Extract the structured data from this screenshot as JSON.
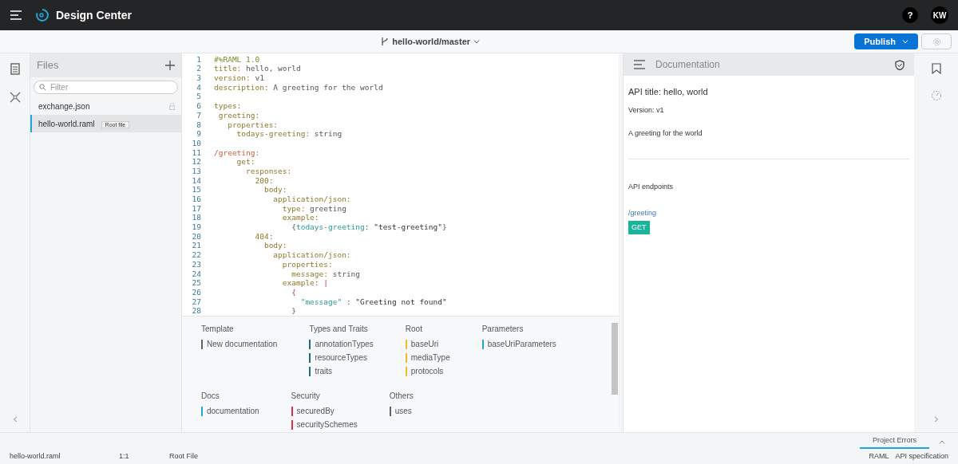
{
  "app": {
    "title": "Design Center",
    "help": "?",
    "avatar": "KW"
  },
  "toolbar": {
    "branch": "hello-world/master",
    "publish": "Publish"
  },
  "files": {
    "title": "Files",
    "filter_placeholder": "Filter",
    "items": [
      {
        "name": "exchange.json",
        "selected": false,
        "locked": true
      },
      {
        "name": "hello-world.raml",
        "selected": true,
        "badge": "Root file"
      }
    ]
  },
  "editor": {
    "lines": [
      {
        "number": "1",
        "tokens": [
          {
            "kind": "comment",
            "text": "#%RAML 1.0"
          }
        ]
      },
      {
        "number": "2",
        "tokens": [
          {
            "kind": "key",
            "text": "title:"
          },
          {
            "kind": "value",
            "text": " hello, world"
          }
        ]
      },
      {
        "number": "3",
        "tokens": [
          {
            "kind": "key",
            "text": "version:"
          },
          {
            "kind": "value",
            "text": " v1"
          }
        ]
      },
      {
        "number": "4",
        "tokens": [
          {
            "kind": "key",
            "text": "description:"
          },
          {
            "kind": "value",
            "text": " A greeting for the world"
          }
        ]
      },
      {
        "number": "5"
      },
      {
        "number": "6",
        "tokens": [
          {
            "kind": "key",
            "text": "types:"
          }
        ]
      },
      {
        "number": "7",
        "tokens": [
          {
            "kind": "key",
            "text": " greeting:"
          }
        ]
      },
      {
        "number": "8",
        "tokens": [
          {
            "kind": "key",
            "text": "   properties:"
          }
        ]
      },
      {
        "number": "9",
        "tokens": [
          {
            "kind": "key",
            "text": "     todays-greeting:"
          },
          {
            "kind": "value",
            "text": " string"
          }
        ]
      },
      {
        "number": "10"
      },
      {
        "number": "11",
        "tokens": [
          {
            "kind": "resource",
            "text": "/greeting:"
          }
        ]
      },
      {
        "number": "12",
        "tokens": [
          {
            "kind": "key",
            "text": "     get:"
          }
        ]
      },
      {
        "number": "13",
        "tokens": [
          {
            "kind": "key",
            "text": "       responses:"
          }
        ]
      },
      {
        "number": "14",
        "tokens": [
          {
            "kind": "key",
            "text": "         200:"
          }
        ]
      },
      {
        "number": "15",
        "tokens": [
          {
            "kind": "key",
            "text": "           body:"
          }
        ]
      },
      {
        "number": "16",
        "tokens": [
          {
            "kind": "key",
            "text": "             application/json:"
          }
        ]
      },
      {
        "number": "17",
        "tokens": [
          {
            "kind": "key",
            "text": "               type:"
          },
          {
            "kind": "value",
            "text": " greeting"
          }
        ]
      },
      {
        "number": "18",
        "tokens": [
          {
            "kind": "key",
            "text": "               example:"
          }
        ]
      },
      {
        "number": "19",
        "tokens": [
          {
            "kind": "value",
            "text": "                 {"
          },
          {
            "kind": "property",
            "text": "todays-greeting"
          },
          {
            "kind": "value",
            "text": ": "
          },
          {
            "kind": "string",
            "text": "\"test-greeting\""
          },
          {
            "kind": "value",
            "text": "}"
          }
        ]
      },
      {
        "number": "20",
        "tokens": [
          {
            "kind": "key",
            "text": "         404:"
          }
        ]
      },
      {
        "number": "21",
        "tokens": [
          {
            "kind": "key",
            "text": "           body:"
          }
        ]
      },
      {
        "number": "22",
        "tokens": [
          {
            "kind": "key",
            "text": "             application/json:"
          }
        ]
      },
      {
        "number": "23",
        "tokens": [
          {
            "kind": "key",
            "text": "               properties:"
          }
        ]
      },
      {
        "number": "24",
        "tokens": [
          {
            "kind": "key",
            "text": "                 message:"
          },
          {
            "kind": "value",
            "text": " string"
          }
        ]
      },
      {
        "number": "25",
        "tokens": [
          {
            "kind": "key",
            "text": "               example:"
          },
          {
            "kind": "brace",
            "text": " |"
          }
        ]
      },
      {
        "number": "26",
        "tokens": [
          {
            "kind": "brace",
            "text": "                 {"
          }
        ]
      },
      {
        "number": "27",
        "tokens": [
          {
            "kind": "property",
            "text": "                   \"message\""
          },
          {
            "kind": "value",
            "text": " : "
          },
          {
            "kind": "string",
            "text": "\"Greeting not found\""
          }
        ]
      },
      {
        "number": "28",
        "tokens": [
          {
            "kind": "value",
            "text": "                 }"
          }
        ]
      }
    ]
  },
  "shelf": {
    "rows": [
      [
        {
          "title": "Template",
          "items": [
            {
              "label": "New documentation",
              "color": "#5f6368"
            }
          ]
        },
        {
          "title": "Types and Traits",
          "items": [
            {
              "label": "annotationTypes",
              "color": "#1f6a8a"
            },
            {
              "label": "resourceTypes",
              "color": "#1f6a8a"
            },
            {
              "label": "traits",
              "color": "#1f6a8a"
            }
          ]
        },
        {
          "title": "Root",
          "items": [
            {
              "label": "baseUri",
              "color": "#f2b82e"
            },
            {
              "label": "mediaType",
              "color": "#f2b82e"
            },
            {
              "label": "protocols",
              "color": "#f2b82e"
            }
          ]
        },
        {
          "title": "Parameters",
          "items": [
            {
              "label": "baseUriParameters",
              "color": "#1ea7d6"
            }
          ]
        }
      ],
      [
        {
          "title": "Docs",
          "items": [
            {
              "label": "documentation",
              "color": "#1ea7d6"
            }
          ]
        },
        {
          "title": "Security",
          "items": [
            {
              "label": "securedBy",
              "color": "#d6304a"
            },
            {
              "label": "securitySchemes",
              "color": "#d6304a"
            }
          ]
        },
        {
          "title": "Others",
          "items": [
            {
              "label": "uses",
              "color": "#5f6368"
            }
          ]
        }
      ]
    ]
  },
  "documentation": {
    "title": "Documentation",
    "api_title": "API title: hello, world",
    "version": "Version: v1",
    "description": "A greeting for the world",
    "endpoints_heading": "API endpoints",
    "endpoints": [
      {
        "path": "/greeting",
        "methods": [
          "GET"
        ]
      }
    ]
  },
  "errors_tab": {
    "label": "Project Errors",
    "selected": true
  },
  "status_bar": {
    "file": "hello-world.raml",
    "position": "1:1",
    "role": "Root File",
    "language": "RAML",
    "kind": "API specification"
  }
}
